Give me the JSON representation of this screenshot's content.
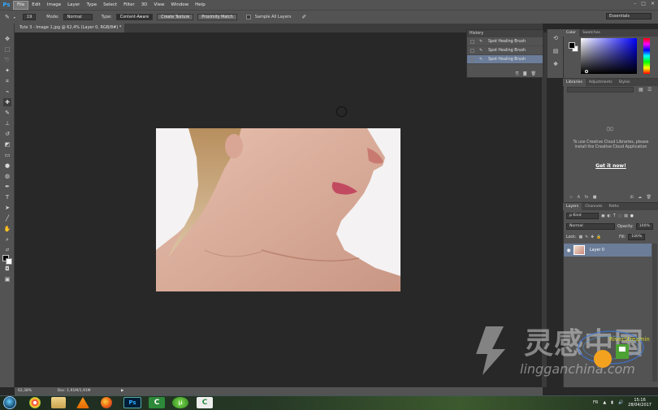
{
  "app": {
    "logo": "Ps",
    "menu": [
      "File",
      "Edit",
      "Image",
      "Layer",
      "Type",
      "Select",
      "Filter",
      "3D",
      "View",
      "Window",
      "Help"
    ],
    "window_controls": [
      "–",
      "□",
      "✕"
    ]
  },
  "options_bar": {
    "brush_size": "19",
    "mode_label": "Mode:",
    "mode_value": "Normal",
    "type_label": "Type:",
    "type_content_aware": "Content-Aware",
    "type_create_texture": "Create Texture",
    "type_proximity_match": "Proximity Match",
    "sample_all_layers": "Sample All Layers",
    "workspace": "Essentials"
  },
  "document": {
    "tab_title": "Tuto 3 - Image 1.jpg @ 62,4% (Layer 0, RGB/8#) *",
    "tab_close": "×",
    "zoom": "62,38%",
    "doc_info": "Doc: 1,91M/1,91M"
  },
  "history": {
    "tab": "History",
    "items": [
      {
        "label": "Spot Healing Brush",
        "selected": false
      },
      {
        "label": "Spot Healing Brush",
        "selected": false
      },
      {
        "label": "Spot Healing Brush",
        "selected": true
      }
    ]
  },
  "color_panel": {
    "tabs": [
      "Color",
      "Swatches"
    ],
    "fg_color": "#000000",
    "bg_color": "#ffffff",
    "hue": "#0000ff"
  },
  "libraries": {
    "tabs": [
      "Libraries",
      "Adjustments",
      "Styles"
    ],
    "message": "To use Creative Cloud Libraries, please install the Creative Cloud Application",
    "link": "Get it now!"
  },
  "layers": {
    "tabs": [
      "Layers",
      "Channels",
      "Paths"
    ],
    "kind_filter": "Kind",
    "blend_mode": "Normal",
    "opacity_label": "Opacity:",
    "opacity_value": "100%",
    "lock_label": "Lock:",
    "fill_label": "Fill:",
    "fill_value": "100%",
    "items": [
      {
        "name": "Layer 0",
        "selected": true
      }
    ]
  },
  "watermark": {
    "text": "灵感中国",
    "url": "lingganchina.com",
    "badge": "RiverStreaming"
  },
  "taskbar": {
    "lang": "FR",
    "time": "15:16",
    "date": "28/04/2017"
  }
}
